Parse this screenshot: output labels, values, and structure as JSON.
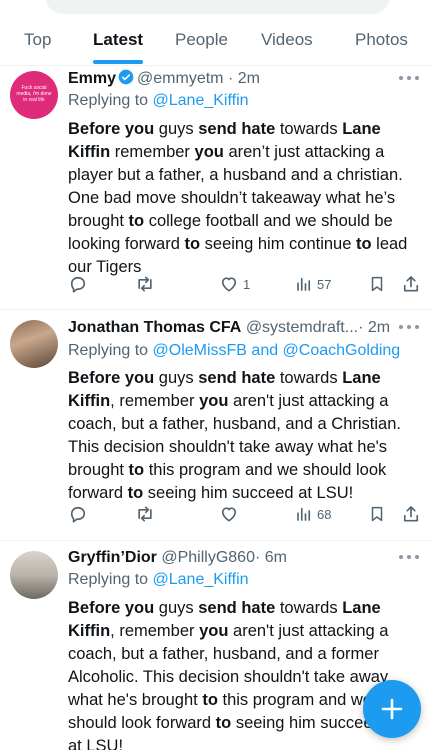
{
  "tabs": [
    {
      "label": "Top"
    },
    {
      "label": "Latest",
      "active": true
    },
    {
      "label": "People"
    },
    {
      "label": "Videos"
    },
    {
      "label": "Photos"
    }
  ],
  "colors": {
    "accent": "#1d9bf0",
    "text": "#0f1419",
    "muted": "#536471"
  },
  "tweets": [
    {
      "name": "Emmy",
      "verified": true,
      "handle": "@emmyetm",
      "time": "· 2m",
      "reply_prefix": "Replying to",
      "reply_to": "@Lane_Kiffin",
      "avatar_text": "Fuck social media, i'm done in real life",
      "segments": [
        {
          "t": "Before you",
          "b": true
        },
        {
          "t": " guys ",
          "b": false
        },
        {
          "t": "send hate",
          "b": true
        },
        {
          "t": " towards ",
          "b": false
        },
        {
          "t": "Lane Kiffin",
          "b": true
        },
        {
          "t": " remember ",
          "b": false
        },
        {
          "t": "you",
          "b": true
        },
        {
          "t": " aren’t just attacking a player but a father, a husband and a christian. One bad move shouldn’t takeaway what he’s brought ",
          "b": false
        },
        {
          "t": "to",
          "b": true
        },
        {
          "t": " college football and we should be looking forward ",
          "b": false
        },
        {
          "t": "to",
          "b": true
        },
        {
          "t": " seeing him continue ",
          "b": false
        },
        {
          "t": "to",
          "b": true
        },
        {
          "t": " lead our Tigers",
          "b": false
        }
      ],
      "likes": "1",
      "views": "57"
    },
    {
      "name": "Jonathan Thomas CFA",
      "verified": false,
      "handle": "@systemdraft...",
      "time": "· 2m",
      "reply_prefix": "Replying to",
      "reply_to": "@OleMissFB and @CoachGolding",
      "segments": [
        {
          "t": "Before you",
          "b": true
        },
        {
          "t": " guys ",
          "b": false
        },
        {
          "t": "send hate",
          "b": true
        },
        {
          "t": " towards ",
          "b": false
        },
        {
          "t": "Lane Kiffin",
          "b": true
        },
        {
          "t": ", remember ",
          "b": false
        },
        {
          "t": "you",
          "b": true
        },
        {
          "t": " aren't just attacking a coach, but a father, husband, and a Christian. This decision shouldn't take away what he's brought ",
          "b": false
        },
        {
          "t": "to",
          "b": true
        },
        {
          "t": " this program and we should look forward ",
          "b": false
        },
        {
          "t": "to",
          "b": true
        },
        {
          "t": " seeing him succeed at LSU!",
          "b": false
        }
      ],
      "likes": "",
      "views": "68"
    },
    {
      "name": "Gryffin’Dior",
      "verified": false,
      "handle": "@PhillyG860",
      "time": "· 6m",
      "reply_prefix": "Replying to",
      "reply_to": "@Lane_Kiffin",
      "segments": [
        {
          "t": "Before you",
          "b": true
        },
        {
          "t": " guys ",
          "b": false
        },
        {
          "t": "send hate",
          "b": true
        },
        {
          "t": " towards ",
          "b": false
        },
        {
          "t": "Lane Kiffin",
          "b": true
        },
        {
          "t": ", remember ",
          "b": false
        },
        {
          "t": "you",
          "b": true
        },
        {
          "t": " aren't just attacking a coach, but a father, husband, and a former Alcoholic. This decision shouldn't take away what he's brought ",
          "b": false
        },
        {
          "t": "to",
          "b": true
        },
        {
          "t": " this program and we should look forward ",
          "b": false
        },
        {
          "t": "to",
          "b": true
        },
        {
          "t": " seeing him succeed at LSU!",
          "b": false
        }
      ]
    }
  ],
  "icons": {
    "reply": "reply-icon",
    "retweet": "retweet-icon",
    "like": "heart-icon",
    "views": "views-icon",
    "bookmark": "bookmark-icon",
    "share": "share-icon",
    "compose": "plus-icon",
    "more": "more-icon",
    "verified": "verified-badge-icon"
  }
}
